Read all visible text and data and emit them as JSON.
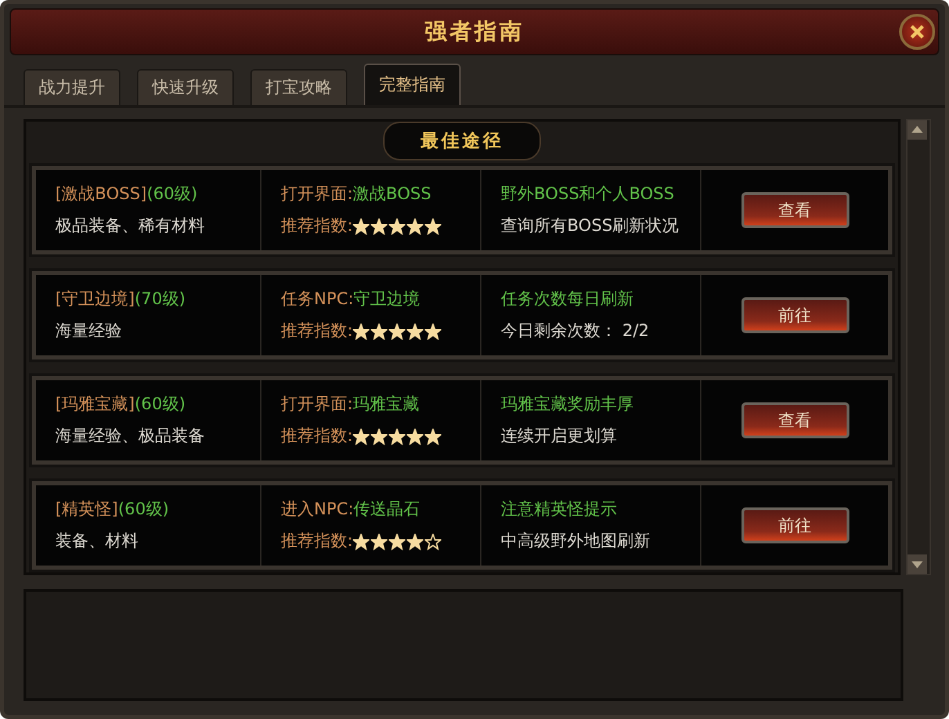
{
  "window": {
    "title": "强者指南"
  },
  "tabs": [
    {
      "label": "战力提升",
      "selected": false
    },
    {
      "label": "快速升级",
      "selected": false
    },
    {
      "label": "打宝攻略",
      "selected": false
    },
    {
      "label": "完整指南",
      "selected": true
    }
  ],
  "section_title": "最佳途径",
  "rows": [
    {
      "name": "[激战BOSS]",
      "level": "(60级)",
      "rewards": "极品装备、稀有材料",
      "entry_label": "打开界面:",
      "entry_value": "激战BOSS",
      "rating_label": "推荐指数:",
      "stars": 5,
      "note": "野外BOSS和个人BOSS",
      "detail": "查询所有BOSS刷新状况",
      "button": "查看"
    },
    {
      "name": "[守卫边境]",
      "level": "(70级)",
      "rewards": "海量经验",
      "entry_label": "任务NPC:",
      "entry_value": "守卫边境",
      "rating_label": "推荐指数:",
      "stars": 5,
      "note": "任务次数每日刷新",
      "detail": "今日剩余次数： 2/2",
      "button": "前往"
    },
    {
      "name": "[玛雅宝藏]",
      "level": "(60级)",
      "rewards": "海量经验、极品装备",
      "entry_label": "打开界面:",
      "entry_value": "玛雅宝藏",
      "rating_label": "推荐指数:",
      "stars": 5,
      "note": "玛雅宝藏奖励丰厚",
      "detail": "连续开启更划算",
      "button": "查看"
    },
    {
      "name": "[精英怪]",
      "level": "(60级)",
      "rewards": "装备、材料",
      "entry_label": "进入NPC:",
      "entry_value": "传送晶石",
      "rating_label": "推荐指数:",
      "stars": 4,
      "note": "注意精英怪提示",
      "detail": "中高级野外地图刷新",
      "button": "前往"
    }
  ]
}
